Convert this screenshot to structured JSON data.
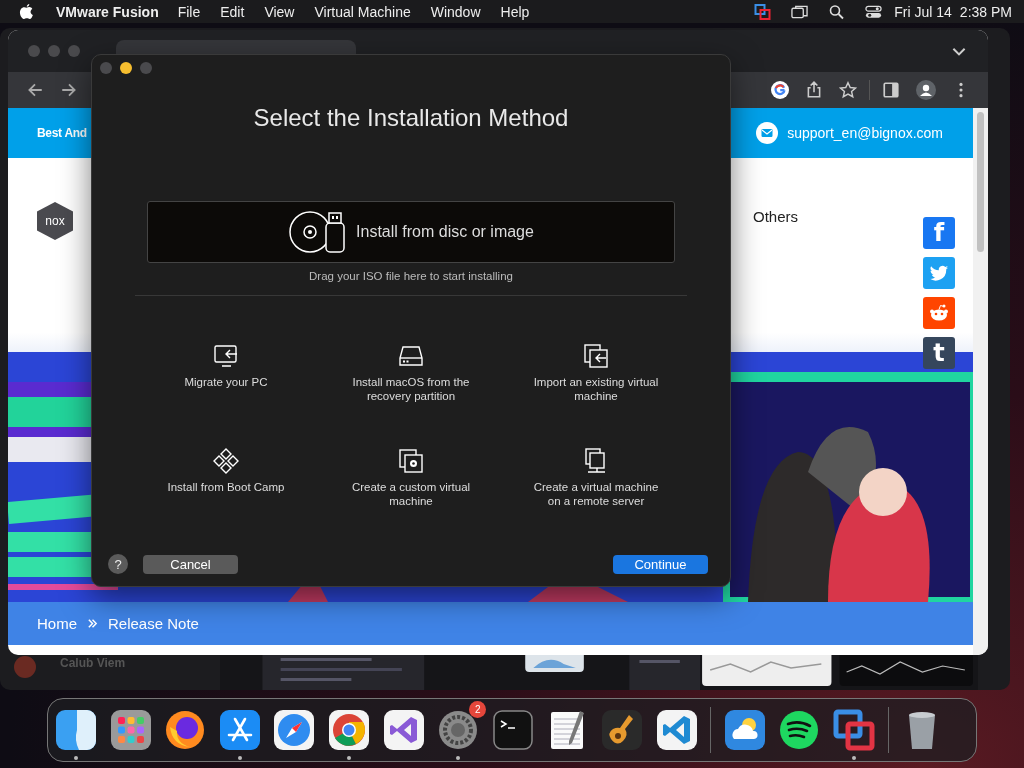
{
  "menu_bar": {
    "app": "VMware Fusion",
    "items": [
      "File",
      "Edit",
      "View",
      "Virtual Machine",
      "Window",
      "Help"
    ],
    "date": "Fri Jul 14",
    "time": "2:38 PM"
  },
  "browser": {
    "website": {
      "top_bar_text": "Best And",
      "email": "support_en@bignox.com",
      "logo": "nox",
      "nav": [
        "Others"
      ],
      "social": [
        {
          "kind": "facebook",
          "glyph": "f"
        },
        {
          "kind": "twitter"
        },
        {
          "kind": "reddit"
        },
        {
          "kind": "tumblr",
          "glyph": "t"
        }
      ],
      "breadcrumb": [
        "Home",
        "Release Note"
      ]
    }
  },
  "background_window": {
    "label": "Calub Viem"
  },
  "dialog": {
    "title": "Select the Installation Method",
    "drop_zone": {
      "label": "Install from disc or image",
      "hint": "Drag your ISO file here to start installing"
    },
    "options": [
      {
        "kind": "migrate",
        "label": "Migrate your PC"
      },
      {
        "kind": "recovery",
        "label": "Install macOS from the recovery partition"
      },
      {
        "kind": "import",
        "label": "Import an existing virtual machine"
      },
      {
        "kind": "bootcamp",
        "label": "Install from Boot Camp"
      },
      {
        "kind": "custom",
        "label": "Create a custom virtual machine"
      },
      {
        "kind": "remote",
        "label": "Create a virtual machine on a remote server"
      }
    ],
    "help": "?",
    "buttons": [
      {
        "kind": "secondary",
        "label": "Cancel"
      },
      {
        "kind": "primary",
        "label": "Continue"
      }
    ]
  },
  "dock": {
    "apps": [
      {
        "kind": "finder",
        "running": true
      },
      {
        "kind": "launchpad",
        "running": false
      },
      {
        "kind": "firefox",
        "running": false
      },
      {
        "kind": "appstore",
        "running": true
      },
      {
        "kind": "safari",
        "running": false
      },
      {
        "kind": "chrome",
        "running": true
      },
      {
        "kind": "visualstudio",
        "running": false
      },
      {
        "kind": "settings",
        "running": true,
        "badge": "2"
      },
      {
        "kind": "terminal",
        "running": false
      },
      {
        "kind": "textedit",
        "running": false
      },
      {
        "kind": "garageband",
        "running": false
      },
      {
        "kind": "vscode",
        "running": false
      },
      {
        "kind": "divider"
      },
      {
        "kind": "weather",
        "running": false
      },
      {
        "kind": "spotify",
        "running": false
      },
      {
        "kind": "vmware",
        "running": true
      },
      {
        "kind": "divider"
      },
      {
        "kind": "trash",
        "running": false
      }
    ]
  }
}
